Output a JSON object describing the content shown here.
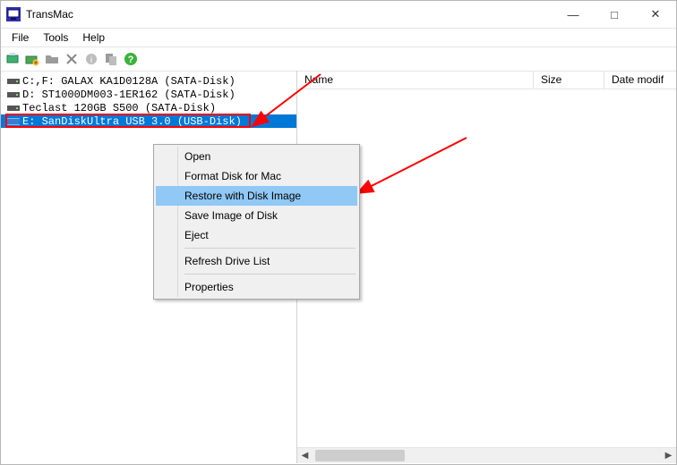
{
  "window": {
    "title": "TransMac",
    "min": "—",
    "max": "□",
    "close": "✕"
  },
  "menus": {
    "file": "File",
    "tools": "Tools",
    "help": "Help"
  },
  "columns": {
    "name": "Name",
    "size": "Size",
    "date": "Date modif"
  },
  "drives": [
    {
      "label": "C:,F: GALAX KA1D0128A (SATA-Disk)"
    },
    {
      "label": "D: ST1000DM003-1ER162 (SATA-Disk)"
    },
    {
      "label": "Teclast 120GB S500 (SATA-Disk)"
    },
    {
      "label": "E: SanDiskUltra USB 3.0 (USB-Disk)"
    }
  ],
  "context": {
    "open": "Open",
    "format": "Format Disk for Mac",
    "restore": "Restore with Disk Image",
    "saveimg": "Save Image of Disk",
    "eject": "Eject",
    "refresh": "Refresh Drive List",
    "props": "Properties"
  },
  "icons": {
    "app": "monitor-icon",
    "open": "folder-open-icon",
    "newfolder": "folder-plus-icon",
    "copy": "copy-icon",
    "delete": "delete-icon",
    "info": "info-icon",
    "files": "files-icon",
    "help": "help-icon"
  },
  "colors": {
    "selection": "#0078d7",
    "highlight_box": "#ff0000",
    "ctx_highlight": "#90c8f6",
    "arrow": "#ff0000"
  }
}
